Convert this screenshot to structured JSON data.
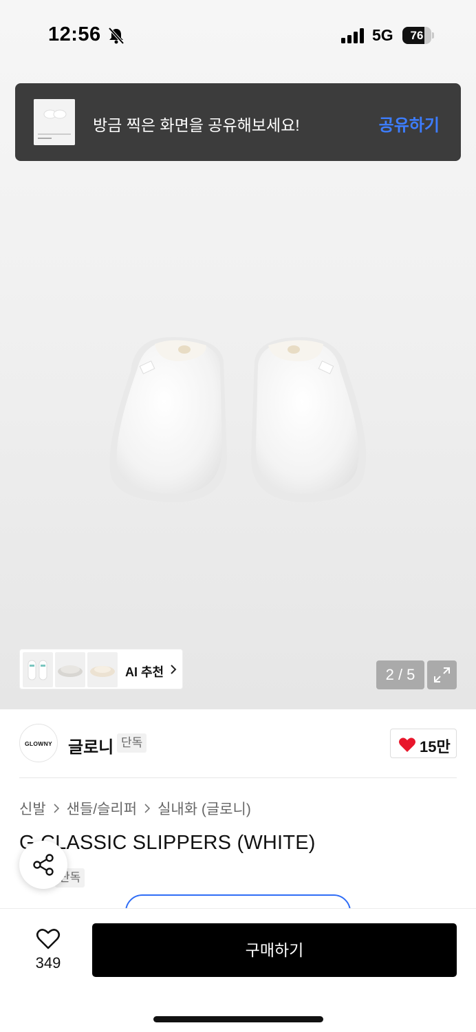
{
  "status_bar": {
    "time": "12:56",
    "network": "5G",
    "battery_level": 76,
    "battery_text": "76",
    "icons": [
      "bell-slash-icon",
      "signal-icon",
      "battery-icon"
    ]
  },
  "share_toast": {
    "message": "방금 찍은 화면을 공유해보세요!",
    "action_label": "공유하기",
    "action_color": "#3d7dff"
  },
  "gallery": {
    "counter": "2 / 5",
    "ai_recommend_label": "AI 추천"
  },
  "brand": {
    "logo_text": "GLOWNY",
    "name": "글로니",
    "badge": "단독",
    "like_count": "15만",
    "heart_color": "#e8162b"
  },
  "breadcrumb": [
    "신발",
    "샌들/슬리퍼",
    "실내화 (글로니)"
  ],
  "product": {
    "title": "G CLASSIC SLIPPERS (WHITE)",
    "badge": "단독"
  },
  "bottom_bar": {
    "like_count": "349",
    "buy_label": "구매하기"
  }
}
